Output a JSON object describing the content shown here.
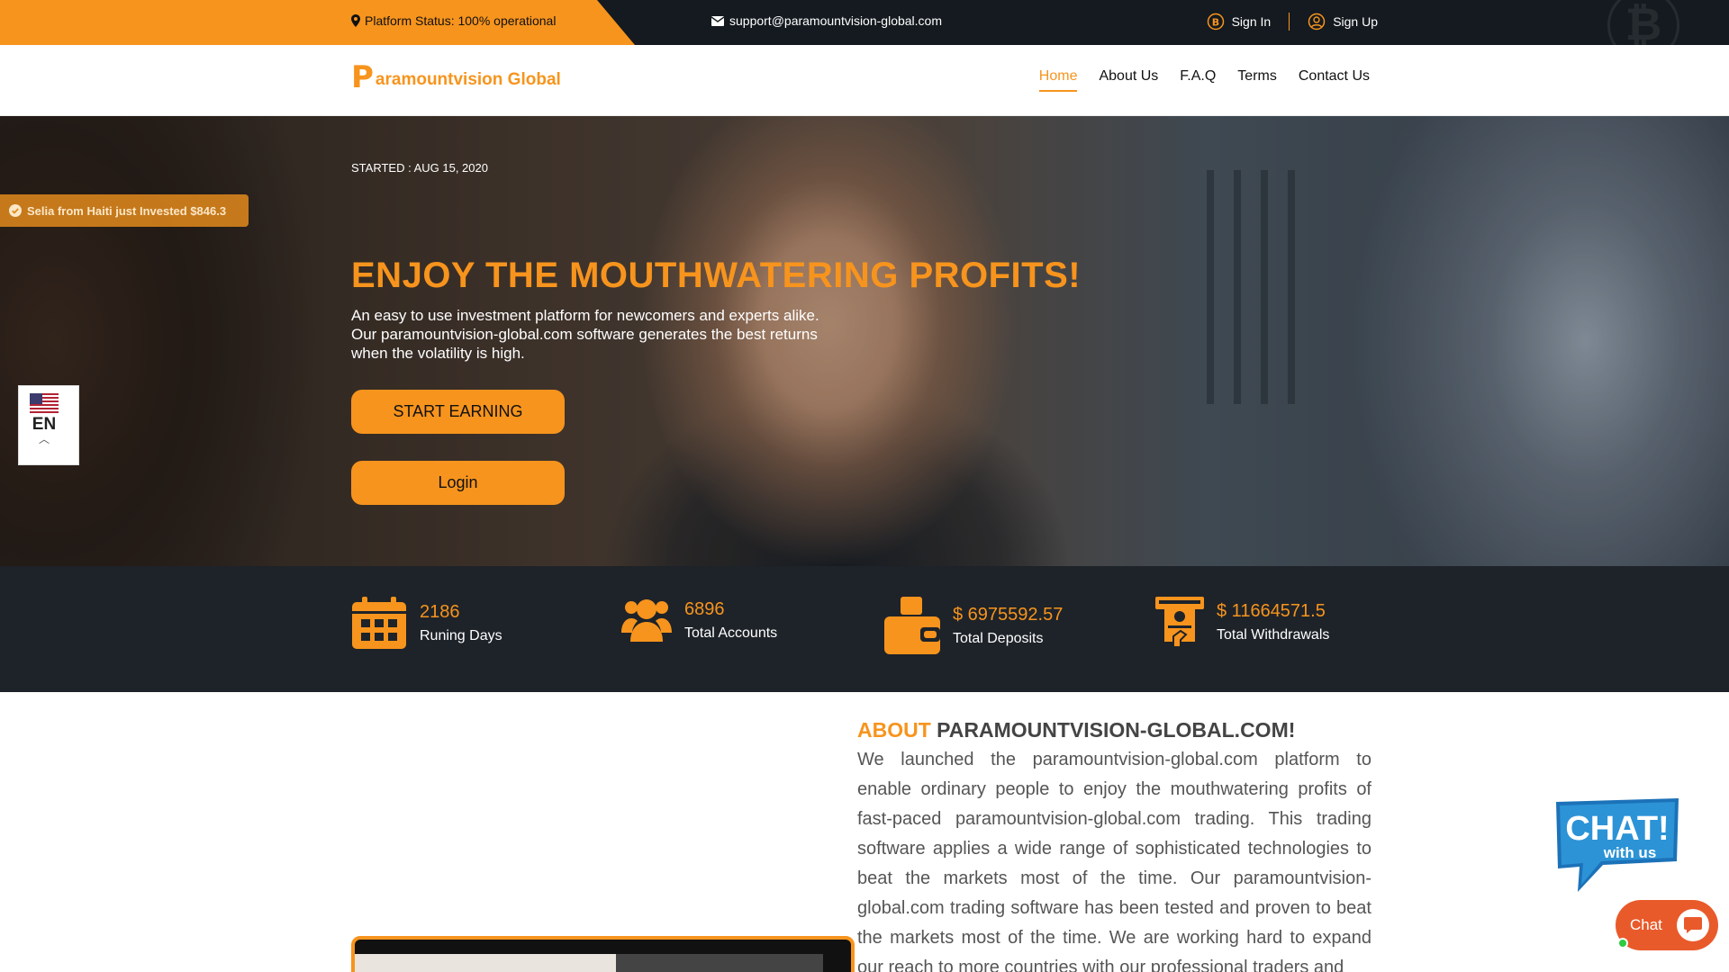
{
  "topbar": {
    "status": "Platform Status: 100% operational",
    "email": "support@paramountvision-global.com",
    "sign_in": "Sign In",
    "sign_up": "Sign Up"
  },
  "header": {
    "logo_mark": "P",
    "logo_text": "aramountvision Global",
    "nav": [
      "Home",
      "About Us",
      "F.A.Q",
      "Terms",
      "Contact Us"
    ]
  },
  "hero": {
    "started": "STARTED : AUG 15, 2020",
    "title": "ENJOY THE MOUTHWATERING PROFITS!",
    "subtitle_lines": [
      "An easy to use investment platform for newcomers and experts alike.",
      "Our paramountvision-global.com software generates the best returns",
      "when the volatility is high."
    ],
    "btn_start": "START EARNING",
    "btn_login": "Login"
  },
  "toast": "Selia from Haiti just Invested $846.3",
  "language": {
    "code": "EN"
  },
  "stats": [
    {
      "value": "2186",
      "label": "Runing Days",
      "icon": "calendar-icon"
    },
    {
      "value": "6896",
      "label": "Total Accounts",
      "icon": "users-icon"
    },
    {
      "value": "$ 6975592.57",
      "label": "Total Deposits",
      "icon": "wallet-icon"
    },
    {
      "value": "$ 11664571.5",
      "label": "Total Withdrawals",
      "icon": "atm-withdraw-icon"
    }
  ],
  "about": {
    "title_accent": "ABOUT",
    "title_rest": "PARAMOUNTVISION-GLOBAL.COM!",
    "text": "We launched the paramountvision-global.com platform to enable ordinary people to enjoy the mouthwatering profits of fast-paced paramountvision-global.com trading. This trading software applies a wide range of sophisticated technologies to beat the markets most of the time. Our paramountvision-global.com trading software has been tested and proven to beat the markets most of the time. We are working hard to expand our reach to more countries with our professional traders and"
  },
  "chat": {
    "bubble_big": "CHAT!",
    "bubble_small": "with us",
    "button": "Chat"
  },
  "colors": {
    "accent": "#f7941d",
    "dark": "#1e2329",
    "chat": "#e95a2b"
  }
}
